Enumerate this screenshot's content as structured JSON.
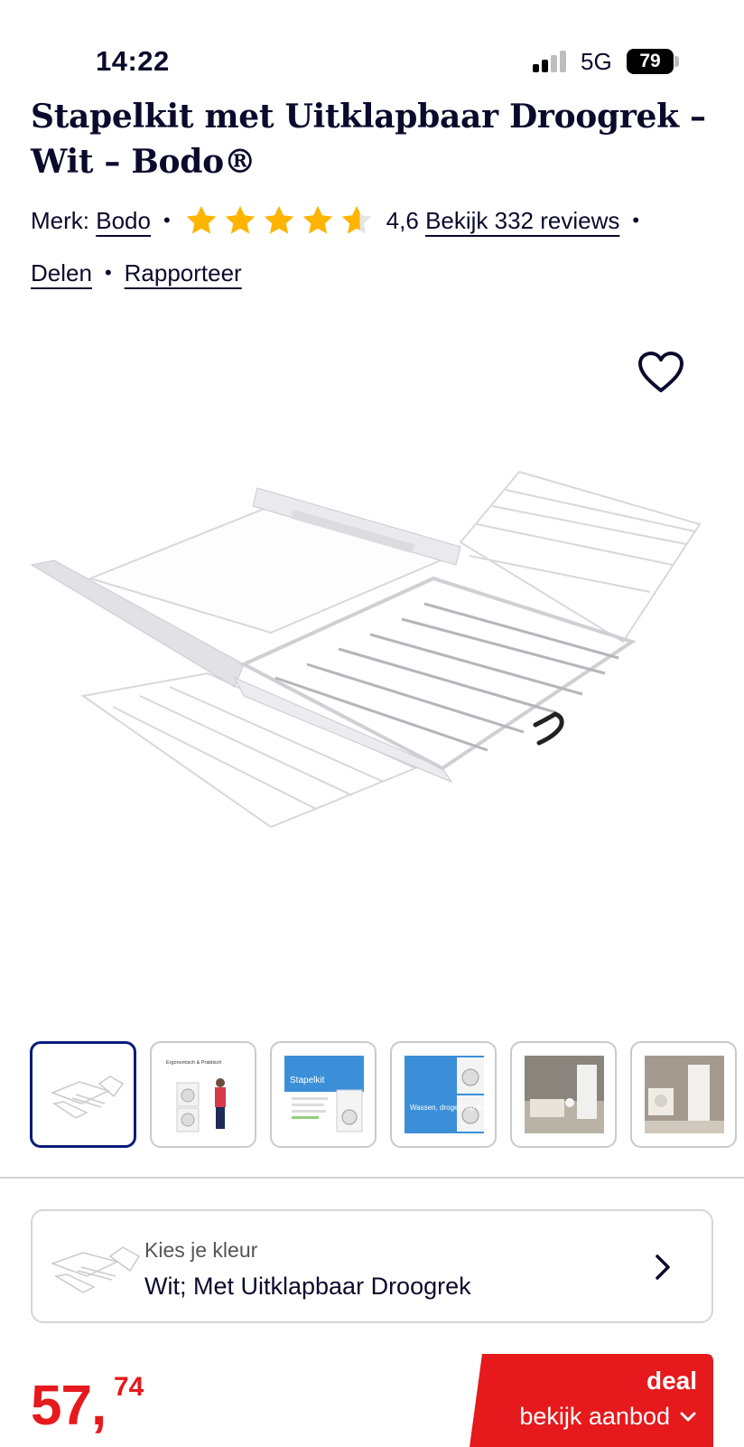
{
  "status_bar": {
    "time": "14:22",
    "network": "5G",
    "battery": "79"
  },
  "product": {
    "title": "Stapelkit met Uitklapbaar Droogrek – Wit – Bodo®",
    "brand_label": "Merk:",
    "brand": "Bodo",
    "rating": 4.6,
    "rating_text": "4,6",
    "reviews_link": "Bekijk 332 reviews",
    "share": "Delen",
    "report": "Rapporteer"
  },
  "gallery": {
    "selected_index": 0,
    "thumbnails": [
      {
        "name": "product-drying-rack",
        "text": ""
      },
      {
        "name": "ergonomic",
        "text": "Ergonomisch & Praktisch"
      },
      {
        "name": "stapelkit",
        "text": "Stapelkit"
      },
      {
        "name": "wassen",
        "text": "Wassen, drogen, op elkaar."
      },
      {
        "name": "lifestyle-1",
        "text": ""
      },
      {
        "name": "lifestyle-2",
        "text": ""
      }
    ]
  },
  "color_selector": {
    "label": "Kies je kleur",
    "value": "Wit; Met Uitklapbaar Droogrek"
  },
  "price": {
    "whole": "57,",
    "cents": "74"
  },
  "deal": {
    "title": "deal",
    "subtitle": "bekijk aanbod"
  },
  "colors": {
    "accent_red": "#e6191c",
    "dark_blue": "#0a1a7a",
    "star": "#ffb400",
    "text": "#0a0a2c"
  }
}
